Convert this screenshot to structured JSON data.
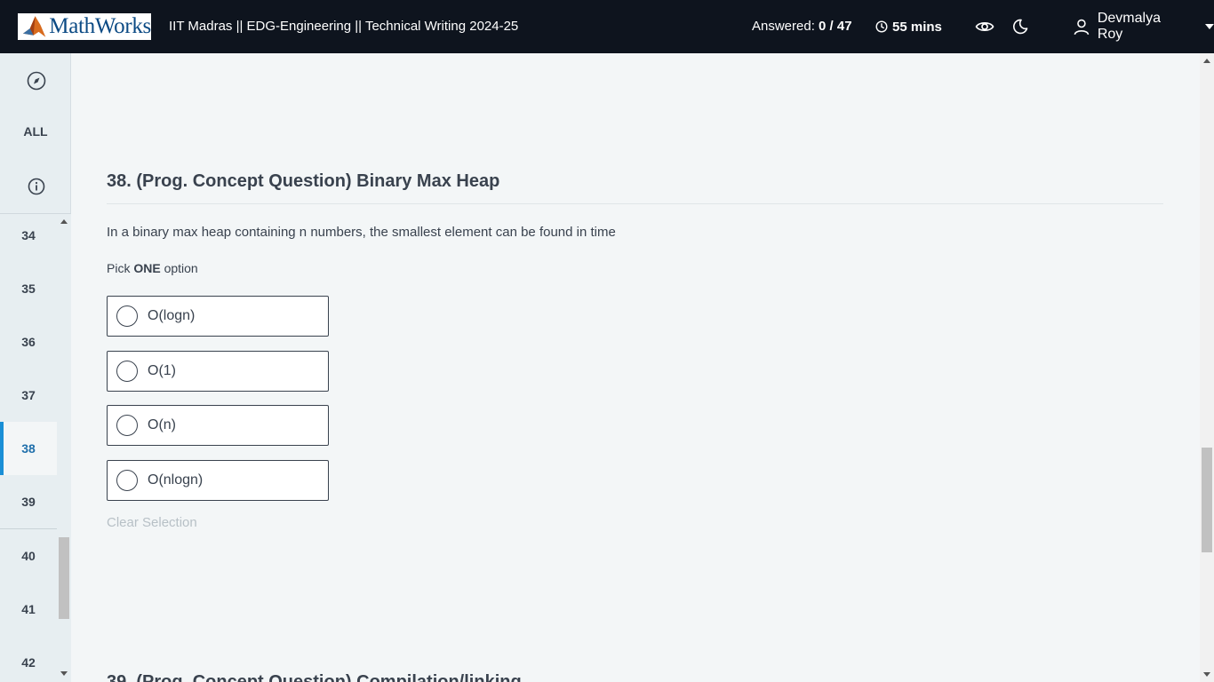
{
  "header": {
    "logo_text": "MathWorks",
    "breadcrumb": "IIT Madras || EDG-Engineering || Technical Writing 2024-25",
    "answered_label": "Answered:",
    "answered_value": "0 / 47",
    "timer": "55 mins",
    "user_name": "Devmalya Roy",
    "icons": {
      "visibility": "eye-icon",
      "theme": "moon-icon",
      "user": "user-icon",
      "menu": "chevron-down-icon",
      "timer": "clock-icon"
    }
  },
  "sidebar": {
    "all_label": "ALL",
    "icons": {
      "top": "compass-icon",
      "info": "info-icon"
    },
    "items": [
      {
        "label": "34"
      },
      {
        "label": "35"
      },
      {
        "label": "36"
      },
      {
        "label": "37"
      },
      {
        "label": "38"
      },
      {
        "label": "39"
      },
      {
        "label": "40"
      },
      {
        "label": "41"
      },
      {
        "label": "42"
      }
    ],
    "active_item": "38"
  },
  "question": {
    "title": "38. (Prog. Concept Question) Binary Max Heap",
    "text": "In a binary max heap containing n numbers, the smallest element can be found in time",
    "pick_prefix": "Pick",
    "pick_bold": "ONE",
    "pick_suffix": "option",
    "options": [
      {
        "label": "O(logn)"
      },
      {
        "label": "O(1)"
      },
      {
        "label": "O(n)"
      },
      {
        "label": "O(nlogn)"
      }
    ],
    "clear_label": "Clear Selection"
  },
  "next_question": {
    "title": "39. (Prog. Concept Question) Compilation/linking"
  },
  "colors": {
    "topbar_bg": "#0e141e",
    "accent_blue": "#1a8fd6",
    "text": "#39424e",
    "sidebar_bg": "#e7eef1",
    "page_bg": "#f3f6f7"
  }
}
